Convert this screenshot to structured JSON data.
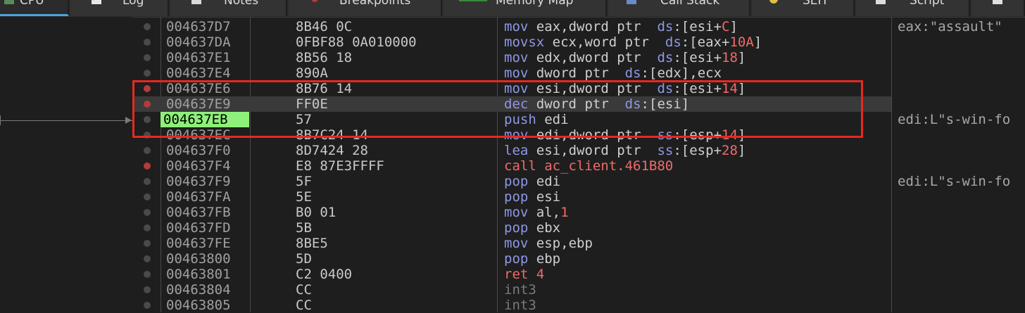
{
  "tabs": [
    {
      "label": "CPU",
      "icon": "cpu-icon",
      "active": true
    },
    {
      "label": "Log",
      "icon": "log-icon"
    },
    {
      "label": "Notes",
      "icon": "notes-icon"
    },
    {
      "label": "Breakpoints",
      "icon": "breakpoint-icon"
    },
    {
      "label": "Memory Map",
      "icon": "memory-map-icon"
    },
    {
      "label": "Call Stack",
      "icon": "call-stack-icon"
    },
    {
      "label": "SEH",
      "icon": "seh-icon"
    },
    {
      "label": "Script",
      "icon": "script-icon"
    }
  ],
  "colors": {
    "background": "#1e1e1e",
    "current_address_bg": "#8ef07a",
    "breakpoint_active": "#b43b3b",
    "mnemonic": "#8f97e6",
    "call_ret": "#f06a6a",
    "highlight_box": "#e8281e"
  },
  "disassembly": [
    {
      "addr": "004637D7",
      "bytes": "8B46 0C",
      "asm": "mov eax,dword ptr  ds:[esi+C]",
      "comment": "eax:\"assault\"",
      "bp": false
    },
    {
      "addr": "004637DA",
      "bytes": "0FBF88 0A010000",
      "asm": "movsx ecx,word ptr  ds:[eax+10A]",
      "comment": "",
      "bp": false
    },
    {
      "addr": "004637E1",
      "bytes": "8B56 18",
      "asm": "mov edx,dword ptr  ds:[esi+18]",
      "comment": "",
      "bp": false
    },
    {
      "addr": "004637E4",
      "bytes": "890A",
      "asm": "mov dword ptr  ds:[edx],ecx",
      "comment": "",
      "bp": false
    },
    {
      "addr": "004637E6",
      "bytes": "8B76 14",
      "asm": "mov esi,dword ptr  ds:[esi+14]",
      "comment": "",
      "bp": true
    },
    {
      "addr": "004637E9",
      "bytes": "FF0E",
      "asm": "dec dword ptr  ds:[esi]",
      "comment": "",
      "bp": true,
      "selected": true
    },
    {
      "addr": "004637EB",
      "bytes": "57",
      "asm": "push edi",
      "comment": "edi:L\"s-win-fo",
      "bp": false,
      "current": true
    },
    {
      "addr": "004637EC",
      "bytes": "8B7C24 14",
      "asm": "mov edi,dword ptr  ss:[esp+14]",
      "comment": "",
      "bp": false
    },
    {
      "addr": "004637F0",
      "bytes": "8D7424 28",
      "asm": "lea esi,dword ptr  ss:[esp+28]",
      "comment": "",
      "bp": false
    },
    {
      "addr": "004637F4",
      "bytes": "E8 87E3FFFF",
      "asm": "call ac_client.461B80",
      "comment": "",
      "bp": true
    },
    {
      "addr": "004637F9",
      "bytes": "5F",
      "asm": "pop edi",
      "comment": "edi:L\"s-win-fo",
      "bp": false
    },
    {
      "addr": "004637FA",
      "bytes": "5E",
      "asm": "pop esi",
      "comment": "",
      "bp": false
    },
    {
      "addr": "004637FB",
      "bytes": "B0 01",
      "asm": "mov al,1",
      "comment": "",
      "bp": false
    },
    {
      "addr": "004637FD",
      "bytes": "5B",
      "asm": "pop ebx",
      "comment": "",
      "bp": false
    },
    {
      "addr": "004637FE",
      "bytes": "8BE5",
      "asm": "mov esp,ebp",
      "comment": "",
      "bp": false
    },
    {
      "addr": "00463800",
      "bytes": "5D",
      "asm": "pop ebp",
      "comment": "",
      "bp": false
    },
    {
      "addr": "00463801",
      "bytes": "C2 0400",
      "asm": "ret 4",
      "comment": "",
      "bp": false
    },
    {
      "addr": "00463804",
      "bytes": "CC",
      "asm": "int3",
      "comment": "",
      "bp": false
    },
    {
      "addr": "00463805",
      "bytes": "CC",
      "asm": "int3",
      "comment": "",
      "bp": false
    }
  ]
}
